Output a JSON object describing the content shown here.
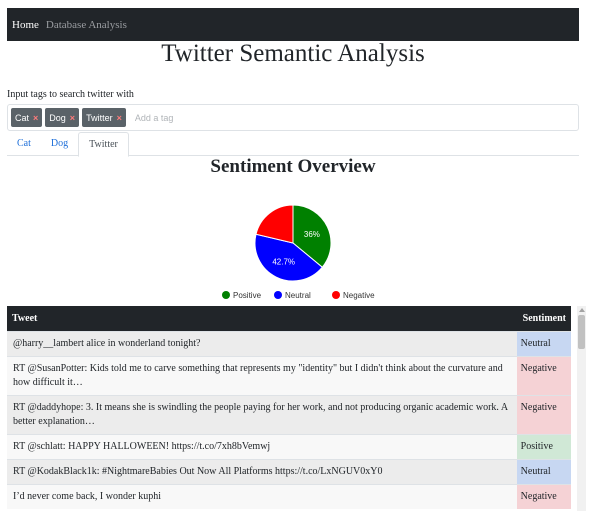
{
  "nav": {
    "home": "Home",
    "database_analysis": "Database Analysis"
  },
  "page_title": "Twitter Semantic Analysis",
  "tag_input": {
    "label": "Input tags to search twitter with",
    "tags": [
      "Cat",
      "Dog",
      "Twitter"
    ],
    "remove_icon": "×",
    "placeholder": "Add a tag"
  },
  "tabs": [
    {
      "label": "Cat",
      "active": false
    },
    {
      "label": "Dog",
      "active": false
    },
    {
      "label": "Twitter",
      "active": true
    }
  ],
  "overview_title": "Sentiment Overview",
  "chart_data": {
    "type": "pie",
    "labels": [
      "Positive",
      "Neutral",
      "Negative"
    ],
    "values": [
      36,
      42.7,
      21.3
    ],
    "data_labels": [
      "36%",
      "42.7%",
      ""
    ],
    "colors": [
      "#008000",
      "#0000ff",
      "#ff0000"
    ],
    "legend_position": "bottom"
  },
  "table": {
    "headers": {
      "tweet": "Tweet",
      "sentiment": "Sentiment"
    },
    "rows": [
      {
        "tweet": "@harry__lambert alice in wonderland tonight?",
        "sentiment": "Neutral"
      },
      {
        "tweet": "RT @SusanPotter: Kids told me to carve something that represents my \"identity\" but I didn't think about the curvature and how difficult it…",
        "sentiment": "Negative"
      },
      {
        "tweet": "RT @daddyhope: 3. It means she is swindling the people paying for her work, and not producing organic academic work. A better explanation…",
        "sentiment": "Negative"
      },
      {
        "tweet": "RT @schlatt: HAPPY HALLOWEEN! https://t.co/7xh8bVemwj",
        "sentiment": "Positive"
      },
      {
        "tweet": "RT @KodakBlack1k: #NightmareBabies Out Now All Platforms https://t.co/LxNGUV0xY0",
        "sentiment": "Neutral"
      },
      {
        "tweet": "I’d never come back, I wonder kuphi",
        "sentiment": "Negative"
      }
    ]
  }
}
